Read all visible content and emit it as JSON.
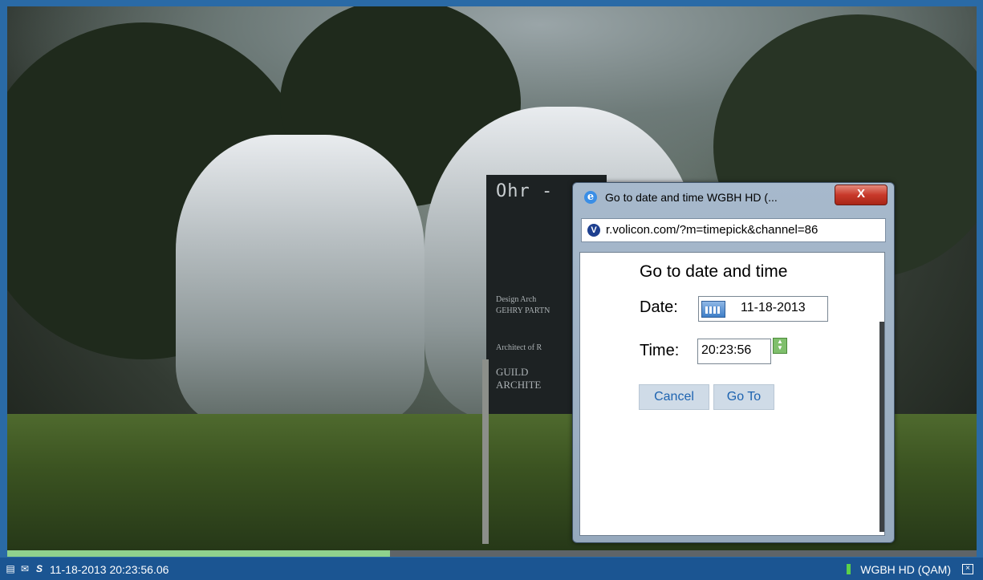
{
  "status_bar": {
    "timestamp": "11-18-2013 20:23:56.06",
    "channel": "WGBH HD (QAM)",
    "icons": [
      "list-icon",
      "envelope-icon",
      "s-logo-icon",
      "close-box-icon"
    ]
  },
  "playback": {
    "progress_fraction": 0.395
  },
  "video": {
    "sign_title": "Ohr -",
    "sign_lines": [
      "Design Arch",
      "GEHRY PARTN",
      "Architect of R",
      "GUILD",
      "ARCHITE"
    ]
  },
  "dialog": {
    "title": "Go to date and time WGBH HD (...",
    "url": "r.volicon.com/?m=timepick&channel=86",
    "close_label": "X",
    "heading": "Go to date and time",
    "date_label": "Date:",
    "date_value": "11-18-2013",
    "time_label": "Time:",
    "time_value": "20:23:56",
    "cancel_label": "Cancel",
    "goto_label": "Go To"
  },
  "colors": {
    "statusbar": "#1b5592",
    "progress_fill": "#8fd18d",
    "link": "#1d63b0"
  }
}
